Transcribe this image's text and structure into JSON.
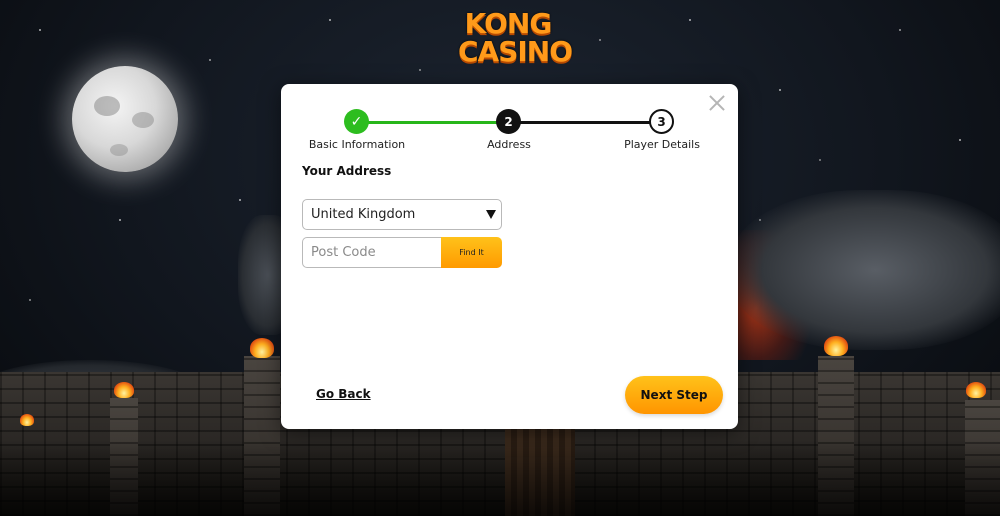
{
  "brand": {
    "logo_line1": "KONG",
    "logo_line2": "CASINO",
    "accent_color": "#ff9a1a"
  },
  "modal": {
    "close_icon": "close-icon",
    "steps": [
      {
        "number": "✓",
        "label": "Basic Information",
        "state": "complete",
        "color": "#2dbd1f"
      },
      {
        "number": "2",
        "label": "Address",
        "state": "current",
        "color": "#111111"
      },
      {
        "number": "3",
        "label": "Player Details",
        "state": "upcoming",
        "color": "#ffffff"
      }
    ],
    "section_title": "Your Address",
    "country": {
      "selected": "United Kingdom"
    },
    "postcode": {
      "value": "",
      "placeholder": "Post Code",
      "find_label": "Find It"
    },
    "back_label": "Go Back",
    "next_label": "Next Step",
    "button_color": "#ffb000"
  }
}
